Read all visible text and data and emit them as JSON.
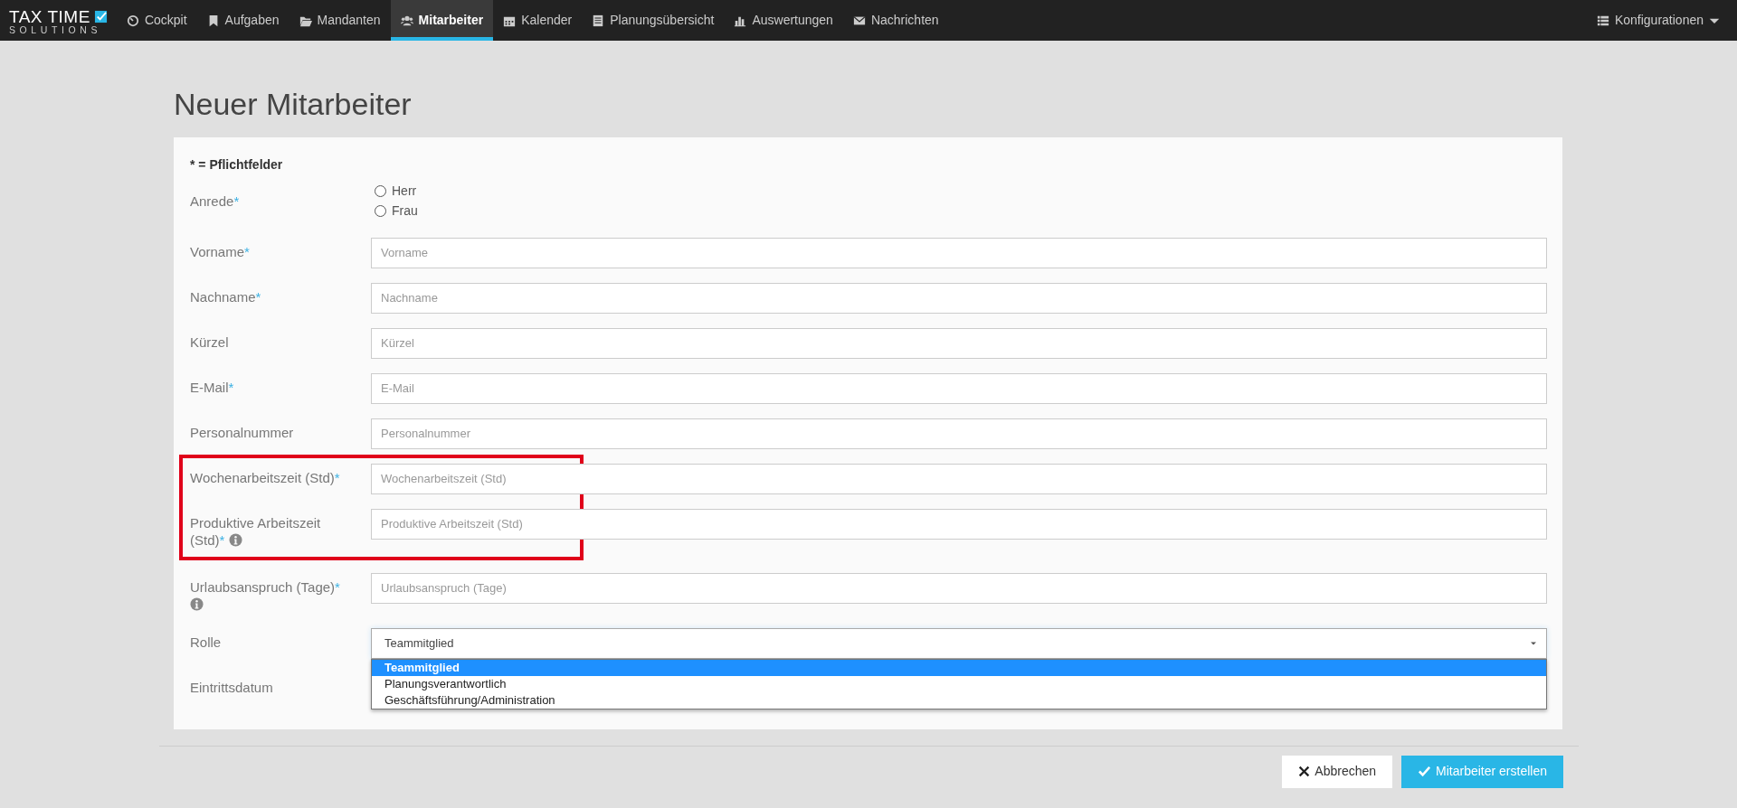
{
  "brand": {
    "line1": "TAX TIME",
    "line2": "SOLUTIONS"
  },
  "nav": [
    {
      "label": "Cockpit",
      "selected": false
    },
    {
      "label": "Aufgaben",
      "selected": false
    },
    {
      "label": "Mandanten",
      "selected": false
    },
    {
      "label": "Mitarbeiter",
      "selected": true
    },
    {
      "label": "Kalender",
      "selected": false
    },
    {
      "label": "Planungsübersicht",
      "selected": false
    },
    {
      "label": "Auswertungen",
      "selected": false
    },
    {
      "label": "Nachrichten",
      "selected": false
    }
  ],
  "config_menu": {
    "label": "Konfigurationen"
  },
  "page_title": "Neuer Mitarbeiter",
  "required_note": "* = Pflichtfelder",
  "fields": [
    {
      "kind": "radio",
      "label": "Anrede",
      "required_mark": "*",
      "options": [
        {
          "label": "Herr",
          "checked": false
        },
        {
          "label": "Frau",
          "checked": false
        }
      ]
    },
    {
      "kind": "text",
      "label": "Vorname",
      "required_mark": "*",
      "placeholder": "Vorname"
    },
    {
      "kind": "text",
      "label": "Nachname",
      "required_mark": "*",
      "placeholder": "Nachname"
    },
    {
      "kind": "text",
      "label": "Kürzel",
      "placeholder": "Kürzel"
    },
    {
      "kind": "text",
      "label": "E-Mail",
      "required_mark": "*",
      "placeholder": "E-Mail"
    },
    {
      "kind": "text",
      "label": "Personalnummer",
      "placeholder": "Personalnummer"
    },
    {
      "kind": "text",
      "label": "Wochenarbeitszeit (Std)",
      "required_mark": "*",
      "placeholder": "Wochenarbeitszeit (Std)",
      "highlighted": true
    },
    {
      "kind": "text",
      "label": "Produktive Arbeitszeit (Std)",
      "required_mark": "*",
      "info": true,
      "placeholder": "Produktive Arbeitszeit (Std)",
      "highlighted": true
    },
    {
      "kind": "text",
      "label": "Urlaubsanspruch (Tage)",
      "required_mark": "*",
      "info": true,
      "placeholder": "Urlaubsanspruch (Tage)"
    },
    {
      "kind": "select",
      "label": "Rolle",
      "value": "Teammitglied",
      "expanded": true,
      "options": [
        {
          "label": "Teammitglied",
          "selected": true
        },
        {
          "label": "Planungsverantwortlich",
          "selected": false
        },
        {
          "label": "Geschäftsführung/Administration",
          "selected": false
        }
      ]
    },
    {
      "kind": "text",
      "label": "Eintrittsdatum"
    }
  ],
  "buttons": [
    {
      "kind": "cancel",
      "label": "Abbrechen"
    },
    {
      "kind": "submit",
      "label": "Mitarbeiter erstellen"
    }
  ]
}
